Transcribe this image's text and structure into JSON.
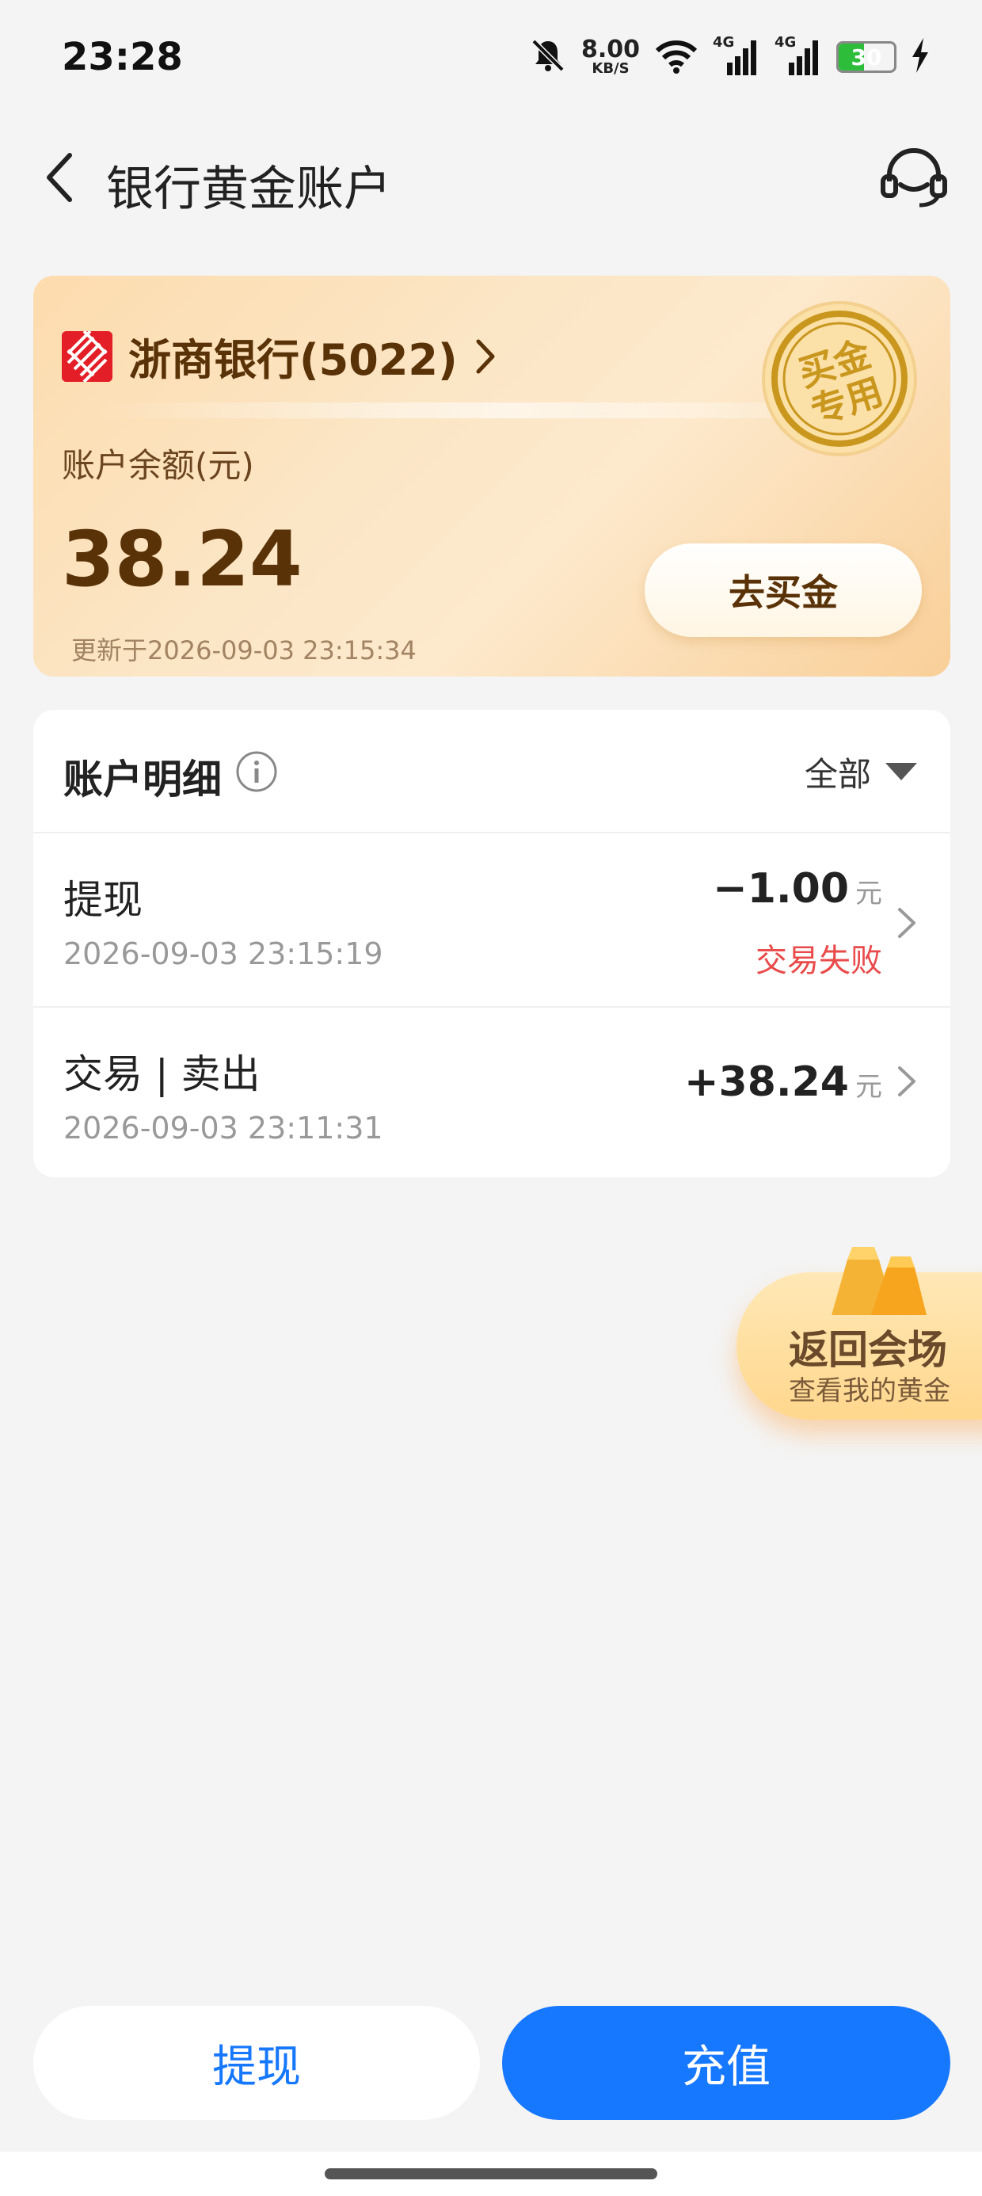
{
  "status_bar": {
    "time": "23:28",
    "net_speed_value": "8.00",
    "net_speed_unit": "KB/S",
    "signal_1_label": "4G",
    "signal_2_label": "4G",
    "battery_level": "30",
    "icons": [
      "mute-bell-icon",
      "wifi-icon",
      "signal-icon",
      "signal-icon",
      "battery-icon",
      "charging-icon"
    ]
  },
  "header": {
    "title": "银行黄金账户",
    "back_icon": "chevron-left-icon",
    "service_icon": "customer-service-icon"
  },
  "account_card": {
    "bank_name": "浙商银行(5022)",
    "balance_label": "账户余额(元)",
    "balance": "38.24",
    "updated_text": "更新于2026-09-03 23:15:34",
    "buy_button": "去买金",
    "seal_text": "买金专用"
  },
  "details": {
    "title": "账户明细",
    "filter_label": "全部",
    "rows": [
      {
        "name": "提现",
        "time": "2026-09-03 23:15:19",
        "amount": "−1.00",
        "unit": "元",
        "status": "交易失败"
      },
      {
        "name": "交易 | 卖出",
        "time": "2026-09-03 23:11:31",
        "amount": "+38.24",
        "unit": "元",
        "status": ""
      }
    ]
  },
  "float_badge": {
    "title": "返回会场",
    "subtitle": "查看我的黄金"
  },
  "bottom": {
    "withdraw": "提现",
    "recharge": "充值"
  },
  "colors": {
    "primary_blue": "#1677ff",
    "fail_red": "#e94a4a",
    "gold_brown": "#5a3208"
  }
}
